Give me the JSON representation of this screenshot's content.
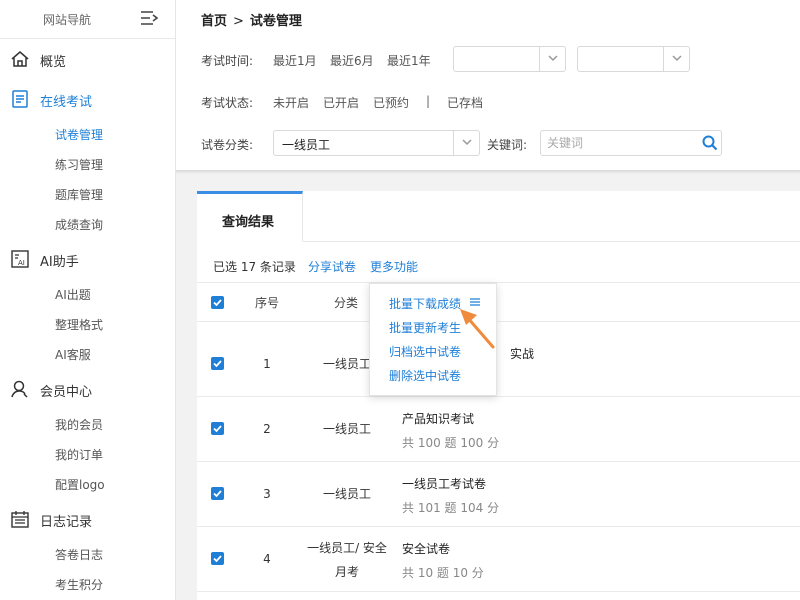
{
  "sidebar": {
    "title": "网站导航",
    "groups": [
      {
        "label": "概览"
      },
      {
        "label": "在线考试",
        "items": [
          "试卷管理",
          "练习管理",
          "题库管理",
          "成绩查询"
        ]
      },
      {
        "label": "AI助手",
        "items": [
          "AI出题",
          "整理格式",
          "AI客服"
        ]
      },
      {
        "label": "会员中心",
        "items": [
          "我的会员",
          "我的订单",
          "配置logo"
        ]
      },
      {
        "label": "日志记录",
        "items": [
          "答卷日志",
          "考生积分"
        ]
      }
    ]
  },
  "breadcrumb": {
    "home": "首页",
    "separator": ">",
    "current": "试卷管理"
  },
  "filters": {
    "time_label": "考试时间:",
    "time_options": [
      "最近1月",
      "最近6月",
      "最近1年"
    ],
    "status_label": "考试状态:",
    "status_options": [
      "未开启",
      "已开启",
      "已预约"
    ],
    "status_divider": "|",
    "status_archived": "已存档",
    "category_label": "试卷分类:",
    "category_value": "一线员工",
    "keyword_label": "关键词:",
    "keyword_placeholder": "关键词"
  },
  "results": {
    "tab_label": "查询结果",
    "selected_info": "已选 17 条记录",
    "share_label": "分享试卷",
    "more_label": "更多功能",
    "columns": {
      "index": "序号",
      "category": "分类"
    },
    "rows": [
      {
        "index": "1",
        "category": "一线员工",
        "name": "实战",
        "meta": ""
      },
      {
        "index": "2",
        "category": "一线员工",
        "name": "产品知识考试",
        "meta": "共 100 题 100 分"
      },
      {
        "index": "3",
        "category": "一线员工",
        "name": "一线员工考试卷",
        "meta": "共 101 题 104 分"
      },
      {
        "index": "4",
        "category_line1": "一线员工/ 安全",
        "category_line2": "月考",
        "name": "安全试卷",
        "meta": "共 10 题 10 分"
      }
    ]
  },
  "more_menu": {
    "items": [
      "批量下载成绩",
      "批量更新考生",
      "归档选中试卷",
      "删除选中试卷"
    ]
  },
  "colors": {
    "accent": "#1f7fd6",
    "annotation": "#f08a3c"
  }
}
